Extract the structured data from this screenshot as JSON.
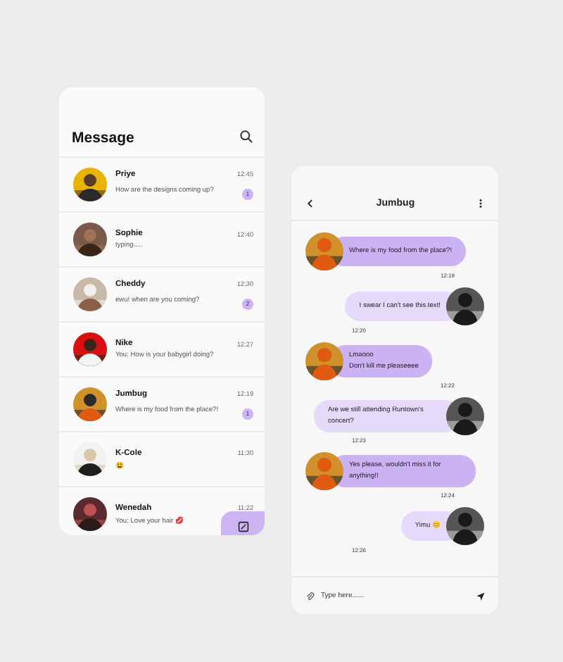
{
  "inbox": {
    "title": "Message",
    "conversations": [
      {
        "name": "Priye",
        "time": "12:45",
        "preview": "How are the designs coming up?",
        "unread": "1"
      },
      {
        "name": "Sophie",
        "time": "12:40",
        "preview": "typing....."
      },
      {
        "name": "Cheddy",
        "time": "12:30",
        "preview": "ewu! when are you coming?",
        "unread": "2"
      },
      {
        "name": "Nike",
        "time": "12:27",
        "preview": "You: How is your babygirl doing?"
      },
      {
        "name": "Jumbug",
        "time": "12:19",
        "preview": "Where is my food from the place?!",
        "unread": "1"
      },
      {
        "name": "K-Cole",
        "time": "11:30",
        "preview": "😫"
      },
      {
        "name": "Wenedah",
        "time": "11:22",
        "preview": "You: Love your hair  💋"
      }
    ]
  },
  "chat": {
    "title": "Jumbug",
    "messages": [
      {
        "kind": "incoming",
        "text": "Where is my food from the place?!",
        "time": "12:19"
      },
      {
        "kind": "outgoing",
        "text": "I swear I can't see this text!",
        "time": "12:20"
      },
      {
        "kind": "incoming",
        "text": "Lmaooo\nDon't kill me pleaseeee",
        "time": "12:22"
      },
      {
        "kind": "outgoing",
        "text": "Are we still attending Runtown's concert?",
        "time": "12:23"
      },
      {
        "kind": "incoming",
        "text": "Yes please, wouldn't miss it for anything!!",
        "time": "12:24"
      },
      {
        "kind": "outgoing",
        "text": "Yimu  😊",
        "time": "12:26"
      }
    ],
    "input": {
      "placeholder": "Type here......"
    }
  }
}
